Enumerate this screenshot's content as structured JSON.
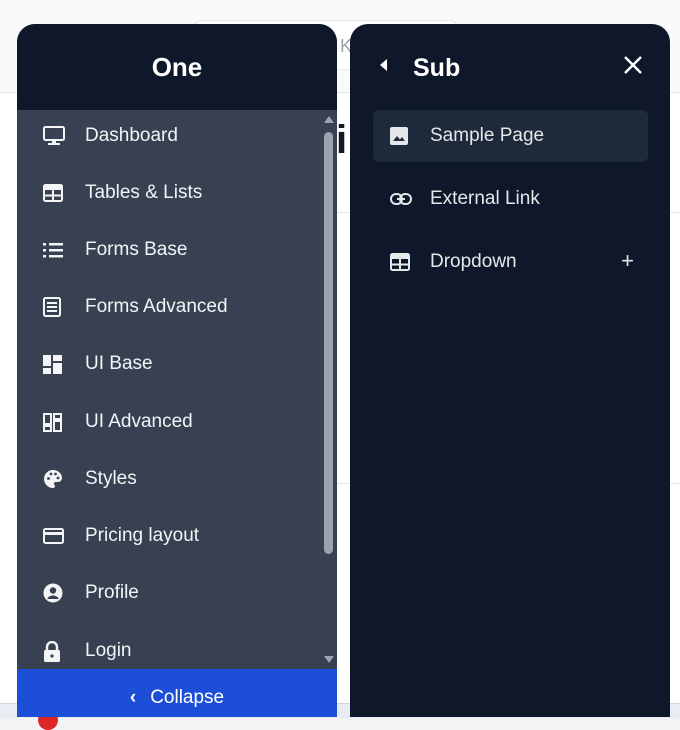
{
  "background": {
    "search_hint": "K",
    "title_fragment": "i"
  },
  "aside": {
    "brand": "One",
    "items": [
      {
        "label": "Dashboard",
        "icon": "monitor-icon"
      },
      {
        "label": "Tables & Lists",
        "icon": "table-icon"
      },
      {
        "label": "Forms Base",
        "icon": "list-icon"
      },
      {
        "label": "Forms Advanced",
        "icon": "form-icon"
      },
      {
        "label": "UI Base",
        "icon": "grid-icon"
      },
      {
        "label": "UI Advanced",
        "icon": "widgets-icon"
      },
      {
        "label": "Styles",
        "icon": "palette-icon"
      },
      {
        "label": "Pricing layout",
        "icon": "credit-card-icon"
      },
      {
        "label": "Profile",
        "icon": "user-circle-icon"
      },
      {
        "label": "Login",
        "icon": "lock-icon"
      }
    ],
    "collapse_label": "Collapse",
    "collapse_chevron": "‹"
  },
  "sub": {
    "title": "Sub",
    "items": [
      {
        "label": "Sample Page",
        "icon": "image-icon",
        "active": true
      },
      {
        "label": "External Link",
        "icon": "link-icon",
        "active": false
      },
      {
        "label": "Dropdown",
        "icon": "table-icon",
        "active": false,
        "expand": "+"
      }
    ]
  },
  "colors": {
    "brand_dark": "#0f172a",
    "aside_bg": "#374151",
    "accent": "#1d4ed8"
  }
}
